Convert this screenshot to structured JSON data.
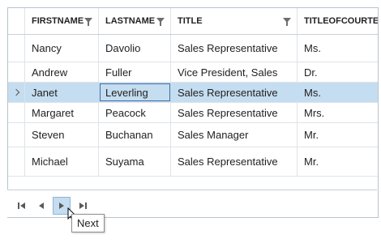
{
  "grid": {
    "columns": [
      "FIRSTNAME",
      "LASTNAME",
      "TITLE",
      "TITLEOFCOURTES"
    ],
    "rows": [
      {
        "first": "Nancy",
        "last": "Davolio",
        "title": "Sales Representative",
        "courtesy": "Ms."
      },
      {
        "first": "Andrew",
        "last": "Fuller",
        "title": "Vice President, Sales",
        "courtesy": "Dr."
      },
      {
        "first": "Janet",
        "last": "Leverling",
        "title": "Sales Representative",
        "courtesy": "Ms."
      },
      {
        "first": "Margaret",
        "last": "Peacock",
        "title": "Sales Representative",
        "courtesy": "Mrs."
      },
      {
        "first": "Steven",
        "last": "Buchanan",
        "title": "Sales Manager",
        "courtesy": "Mr."
      },
      {
        "first": "Michael",
        "last": "Suyama",
        "title": "Sales Representative",
        "courtesy": "Mr."
      }
    ],
    "selected_row_index": 2,
    "selection_color": "#c5ddf0"
  },
  "pager": {
    "buttons": [
      "first-page-icon",
      "previous-page-icon",
      "next-page-icon",
      "last-page-icon"
    ],
    "tooltip": "Next"
  }
}
